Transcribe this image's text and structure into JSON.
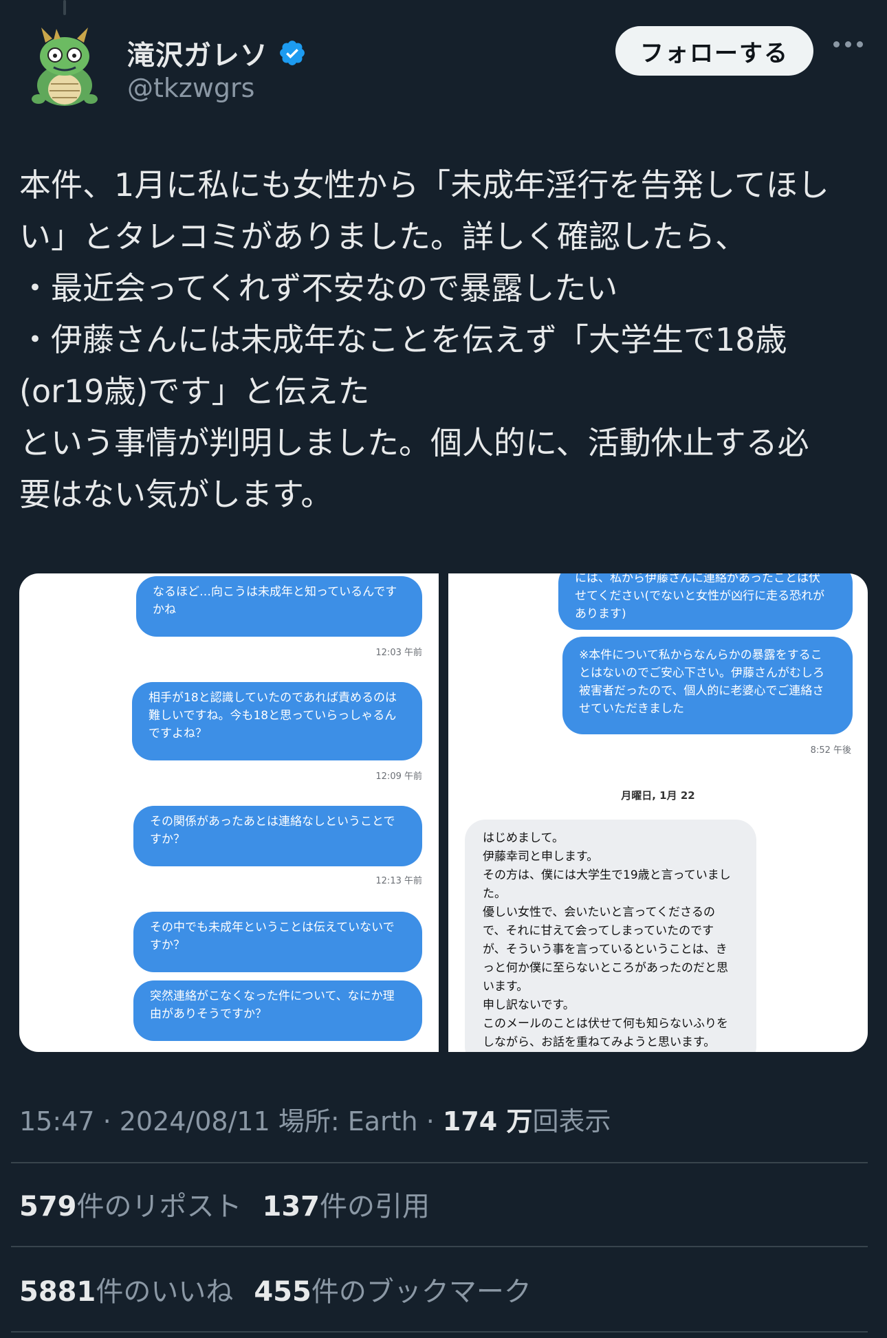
{
  "user": {
    "name": "滝沢ガレソ",
    "handle": "@tkzwgrs",
    "follow_label": "フォローする"
  },
  "tweet": {
    "text": "本件、1月に私にも女性から「未成年淫行を告発してほし\nい」とタレコミがありました。詳しく確認したら、\n・最近会ってくれず不安なので暴露したい\n・伊藤さんには未成年なことを伝えず「大学生で18歳\n(or19歳)です」と伝えた\nという事情が判明しました。個人的に、活動休止する必\n要はない気がします。"
  },
  "screenshot_left": {
    "messages": [
      {
        "text": "なるほど…向こうは未成年と知っているんです\nかね",
        "time": "12:03 午前"
      },
      {
        "text": "相手が18と認識していたのであれば責めるのは\n難しいですね。今も18と思っていらっしゃるん\nですよね？",
        "time": "12:09 午前"
      },
      {
        "text": "その関係があったあとは連絡なしということで\nすか？",
        "time": "12:13 午前"
      },
      {
        "text": "その中でも未成年ということは伝えていないで\nすか？",
        "time": ""
      },
      {
        "text": "突然連絡がこなくなった件について、なにか理\n由がありそうですか？",
        "time": ""
      }
    ]
  },
  "screenshot_right": {
    "messages_out": [
      {
        "text": "には、私から伊藤さんに連絡があったことは伏\nせてください(でないと女性が凶行に走る恐れが\nあります)"
      },
      {
        "text": "※本件について私からなんらかの暴露をするこ\nとはないのでご安心下さい。伊藤さんがむしろ\n被害者だったので、個人的に老婆心でご連絡さ\nせていただきました",
        "time": "8:52 午後"
      }
    ],
    "date_separator": "月曜日, 1月 22",
    "message_in": "はじめまして。\n伊藤幸司と申します。\nその方は、僕には大学生で19歳と言っていまし\nた。\n優しい女性で、会いたいと言ってくださるの\nで、それに甘えて会ってしまっていたのです\nが、そういう事を言っているということは、き\nっと何か僕に至らないところがあったのだと思\nいます。\n申し訳ないです。\nこのメールのことは伏せて何も知らないふりを\nしながら、お話を重ねてみようと思います。"
  },
  "meta": {
    "time_date": "15:47 · 2024/08/11",
    "location": " 場所: Earth · ",
    "views_count": "174 万",
    "views_label": "回表示"
  },
  "stats": {
    "reposts_count": "579",
    "reposts_label": "件のリポスト",
    "quotes_count": "137",
    "quotes_label": "件の引用",
    "likes_count": "5881",
    "likes_label": "件のいいね",
    "bookmarks_count": "455",
    "bookmarks_label": "件のブックマーク"
  }
}
